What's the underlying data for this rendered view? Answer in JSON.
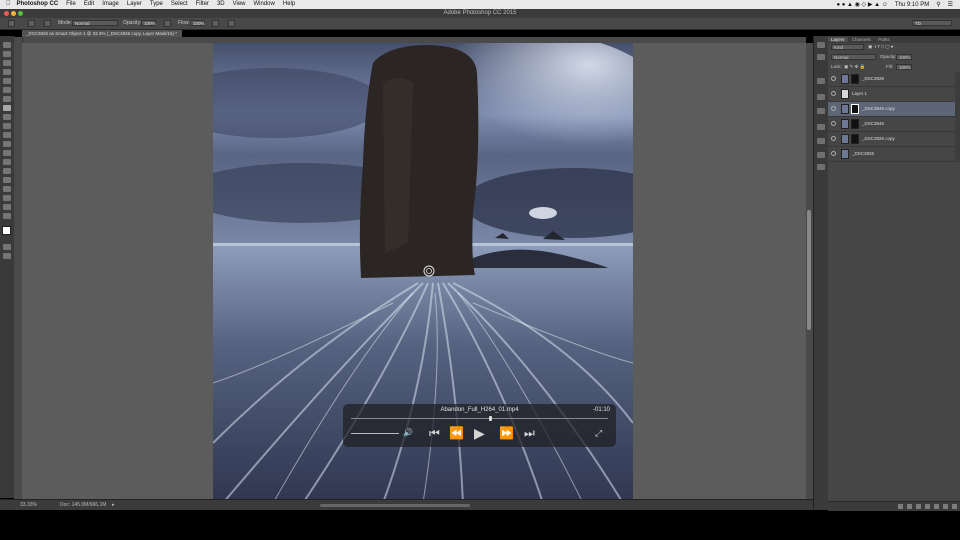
{
  "menubar": {
    "apple": "",
    "app": "Photoshop CC",
    "items": [
      "File",
      "Edit",
      "Image",
      "Layer",
      "Type",
      "Select",
      "Filter",
      "3D",
      "View",
      "Window",
      "Help"
    ],
    "clock": "Thu 9:10 PM"
  },
  "window": {
    "title": "Adobe Photoshop CC 2015"
  },
  "options": {
    "mode_label": "Mode:",
    "mode_value": "Normal",
    "opacity_label": "Opacity:",
    "opacity_value": "100%",
    "flow_label": "Flow:",
    "flow_value": "100%",
    "workspace": "TD"
  },
  "document": {
    "tab_title": "_DSC3826 as Smart Object-1 @ 33.3% (_DSC3846 copy, Layer Mask/16) *",
    "zoom": "33.33%",
    "doc_info": "Doc: 145.0M/666.1M"
  },
  "player": {
    "filename": "Abandon_Full_H264_01.mp4",
    "remaining": "-01:10"
  },
  "panel": {
    "tabs": [
      "Layers",
      "Channels",
      "Paths"
    ],
    "kind_label": "Kind",
    "blend_value": "Normal",
    "opacity_label": "Opacity:",
    "opacity_value": "100%",
    "lock_label": "Lock:",
    "fill_label": "Fill:",
    "fill_value": "100%",
    "layers": [
      {
        "name": "_DSC3826"
      },
      {
        "name": "Layer 1"
      },
      {
        "name": "_DSC3846 copy"
      },
      {
        "name": "_DSC3846"
      },
      {
        "name": "_DSC3826 copy"
      },
      {
        "name": "_DSC3826"
      }
    ]
  },
  "colors": {
    "accent_selected": "#5d6677",
    "panel_bg": "#464646",
    "canvas_bg": "#5c5c5c"
  }
}
